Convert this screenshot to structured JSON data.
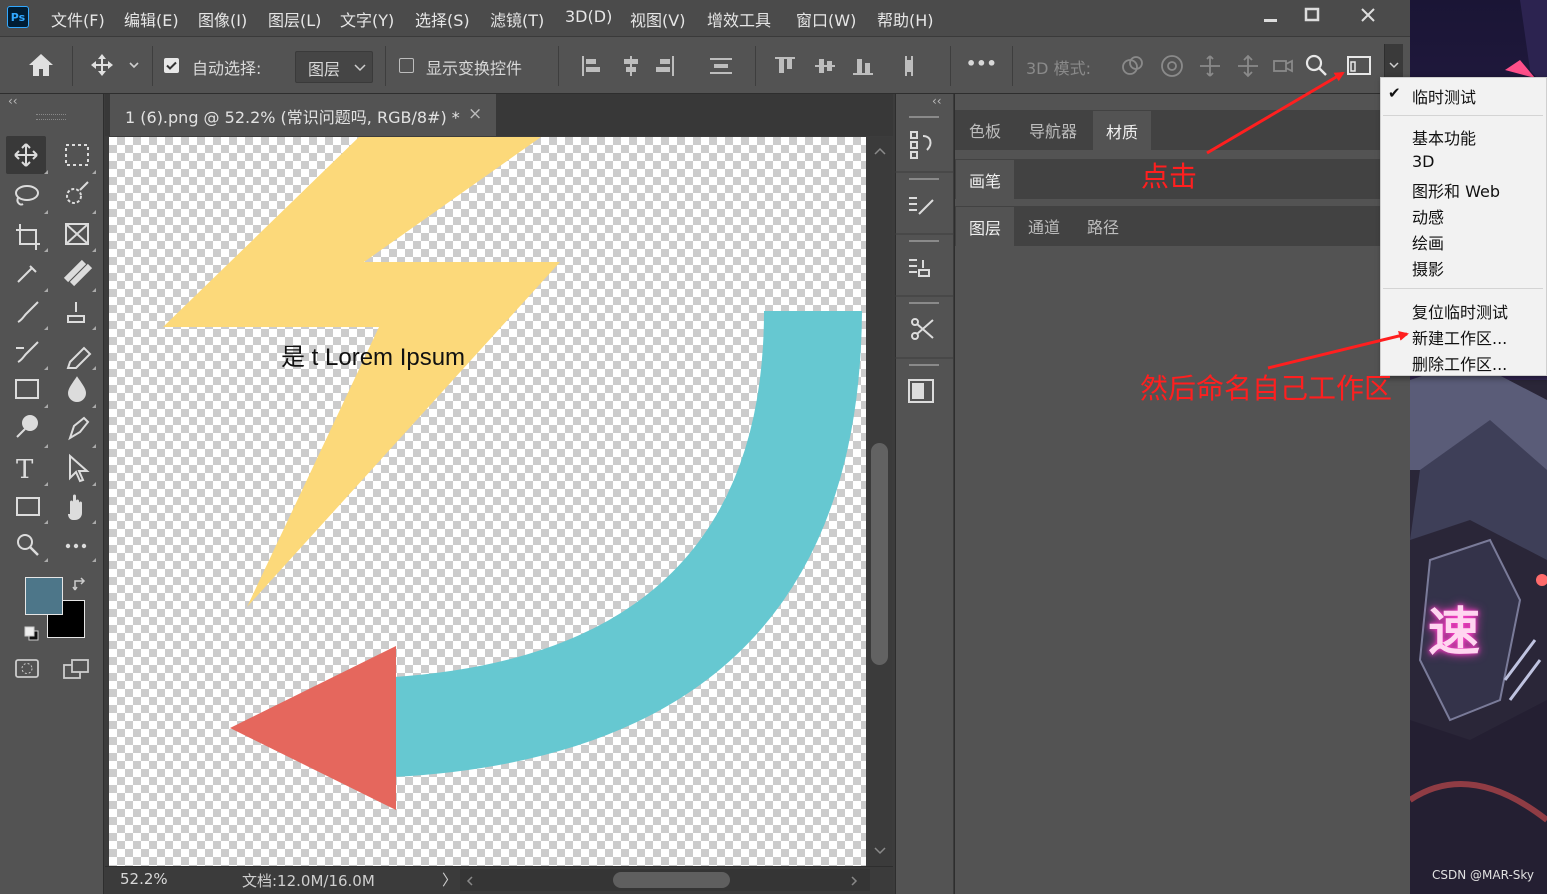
{
  "app": {
    "logo": "Ps"
  },
  "menu": [
    "文件(F)",
    "编辑(E)",
    "图像(I)",
    "图层(L)",
    "文字(Y)",
    "选择(S)",
    "滤镜(T)",
    "3D(D)",
    "视图(V)",
    "增效工具",
    "窗口(W)",
    "帮助(H)"
  ],
  "options": {
    "auto_select_label": "自动选择:",
    "auto_select_value": "图层",
    "show_transform_label": "显示变换控件",
    "more_label": "•••",
    "mode_3d_label": "3D 模式:"
  },
  "panel_collapse": "‹‹",
  "document": {
    "tab_title": "1 (6).png @ 52.2% (常识问题吗, RGB/8#) *",
    "close": "×",
    "canvas_text": "是 t Lorem Ipsum",
    "zoom": "52.2%",
    "doc_size": "文档:12.0M/16.0M",
    "status_arrow": "〉"
  },
  "panels": {
    "group1_tabs": [
      "色板",
      "导航器",
      "材质"
    ],
    "group2_tabs": [
      "画笔"
    ],
    "group3_tabs": [
      "图层",
      "通道",
      "路径"
    ]
  },
  "workspace_menu": {
    "checkmark": "✔",
    "items": [
      "临时测试",
      "基本功能",
      "3D",
      "图形和 Web",
      "动感",
      "绘画",
      "摄影",
      "复位临时测试",
      "新建工作区...",
      "删除工作区..."
    ]
  },
  "annotations": {
    "click": "点击",
    "name_workspace": "然后命名自己工作区"
  },
  "wallpaper": {
    "glyph": "速",
    "credit": "CSDN @MAR-Sky"
  },
  "colors": {
    "lightning": "#fcd97a",
    "arc": "#66c8d1",
    "arrowhead": "#e5675d",
    "foreground": "#4d7689",
    "background": "#000000",
    "annotation": "#ff1f1f"
  }
}
